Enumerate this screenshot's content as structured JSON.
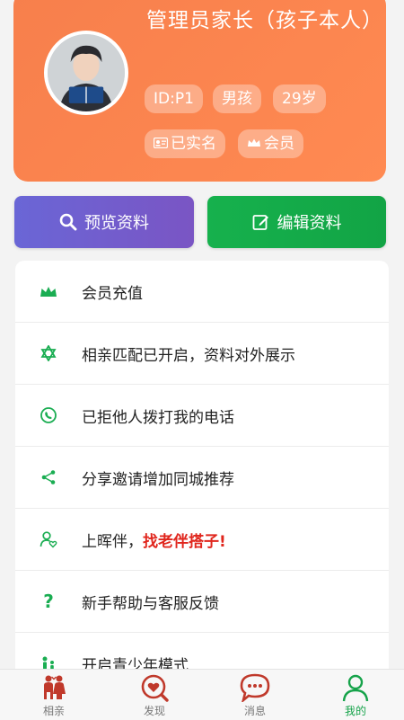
{
  "profile": {
    "name": "管理员家长（孩子本人）",
    "chips": [
      "ID:P1",
      "男孩",
      "29岁"
    ],
    "badges": [
      {
        "icon": "id-card-icon",
        "label": "已实名"
      },
      {
        "icon": "crown-icon",
        "label": "会员"
      }
    ]
  },
  "actions": {
    "preview_label": "预览资料",
    "edit_label": "编辑资料"
  },
  "menu": {
    "items": [
      {
        "icon": "crown-icon",
        "label": "会员充值"
      },
      {
        "icon": "star-of-david-icon",
        "label": "相亲匹配已开启，资料对外展示"
      },
      {
        "icon": "whatsapp-phone-icon",
        "label": "已拒他人拨打我的电话"
      },
      {
        "icon": "share-icon",
        "label": "分享邀请增加同城推荐"
      },
      {
        "icon": "user-heart-icon",
        "label": "上晖伴，",
        "highlight": "找老伴搭子!"
      },
      {
        "icon": "question-icon",
        "label": "新手帮助与客服反馈"
      },
      {
        "icon": "teen-mode-icon",
        "label": "开启青少年模式"
      }
    ]
  },
  "tabbar": {
    "tabs": [
      {
        "icon": "couple-icon",
        "label": "相亲"
      },
      {
        "icon": "discover-heart-icon",
        "label": "发现"
      },
      {
        "icon": "message-bubble-icon",
        "label": "消息"
      },
      {
        "icon": "user-outline-icon",
        "label": "我的",
        "active": true
      }
    ]
  },
  "colors": {
    "accent_orange": "#f77f4c",
    "accent_green": "#16a34a",
    "accent_purple": "#6a66d6",
    "highlight_red": "#e0261d"
  }
}
